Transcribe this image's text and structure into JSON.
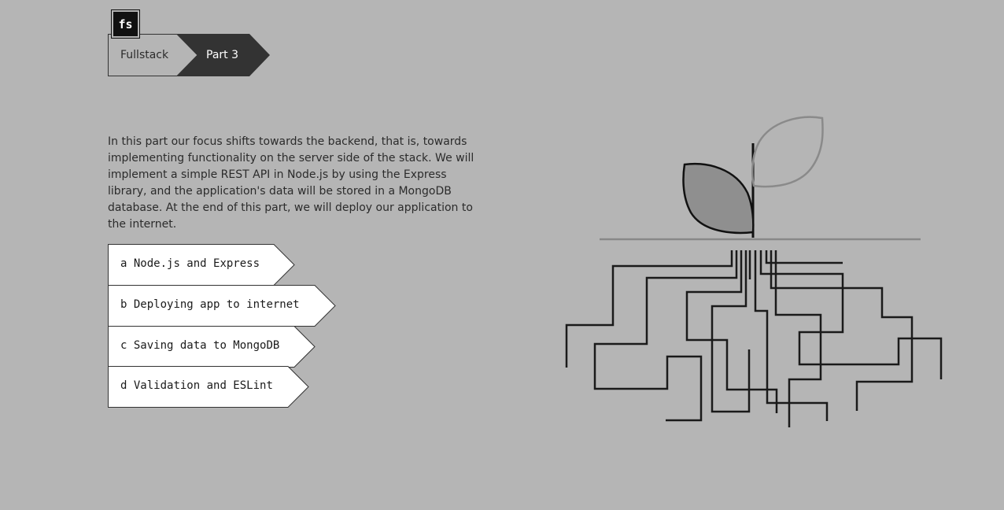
{
  "logo": {
    "text": "fs"
  },
  "breadcrumb": {
    "items": [
      {
        "label": "Fullstack"
      },
      {
        "label": "Part 3"
      }
    ]
  },
  "intro": {
    "text": "In this part our focus shifts towards the backend, that is, towards implementing functionality on the server side of the stack. We will implement a simple REST API in Node.js by using the Express library, and the application's data will be stored in a MongoDB database. At the end of this part, we will deploy our application to the internet."
  },
  "toc": {
    "items": [
      {
        "letter": "a",
        "title": "Node.js and Express"
      },
      {
        "letter": "b",
        "title": "Deploying app to internet"
      },
      {
        "letter": "c",
        "title": "Saving data to MongoDB"
      },
      {
        "letter": "d",
        "title": "Validation and ESLint"
      }
    ]
  },
  "illustration": {
    "name": "plant-with-circuit-roots"
  },
  "colors": {
    "background": "#b5b5b5",
    "dark": "#2b2b2b",
    "card": "#ffffff"
  }
}
